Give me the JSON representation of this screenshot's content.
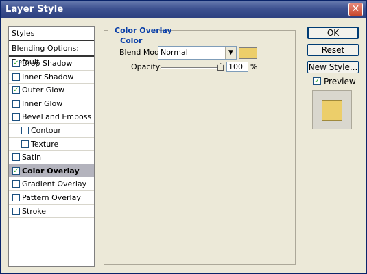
{
  "window": {
    "title": "Layer Style",
    "close_symbol": "✕"
  },
  "left_panel": {
    "header": "Styles",
    "blending_options": "Blending Options: Default",
    "items": [
      {
        "label": "Drop Shadow",
        "checked": true
      },
      {
        "label": "Inner Shadow",
        "checked": false
      },
      {
        "label": "Outer Glow",
        "checked": true
      },
      {
        "label": "Inner Glow",
        "checked": false
      },
      {
        "label": "Bevel and Emboss",
        "checked": false
      },
      {
        "label": "Contour",
        "checked": false
      },
      {
        "label": "Texture",
        "checked": false
      },
      {
        "label": "Satin",
        "checked": false
      },
      {
        "label": "Color Overlay",
        "checked": true,
        "selected": true
      },
      {
        "label": "Gradient Overlay",
        "checked": false
      },
      {
        "label": "Pattern Overlay",
        "checked": false
      },
      {
        "label": "Stroke",
        "checked": false
      }
    ]
  },
  "color_overlay": {
    "title": "Color Overlay",
    "color_group_title": "Color",
    "blend_mode_label": "Blend Mode:",
    "blend_mode_value": "Normal",
    "overlay_color": "#ecce6a",
    "opacity_label": "Opacity:",
    "opacity_value": "100",
    "opacity_unit": "%"
  },
  "buttons": {
    "ok": "OK",
    "reset": "Reset",
    "new_style": "New Style...",
    "preview_label": "Preview",
    "preview_checked": true
  }
}
